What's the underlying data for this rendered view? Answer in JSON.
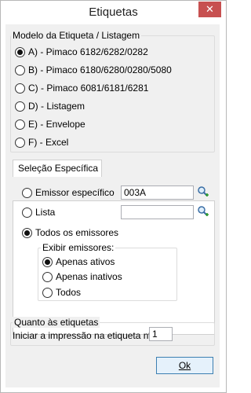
{
  "window": {
    "title": "Etiquetas",
    "close_glyph": "✕"
  },
  "modelo": {
    "legend": "Modelo da Etiqueta / Listagem",
    "options": [
      {
        "label": "A) - Pimaco 6182/6282/0282",
        "checked": true
      },
      {
        "label": "B) - Pimaco 6180/6280/0280/5080",
        "checked": false
      },
      {
        "label": "C) - Pimaco 6081/6181/6281",
        "checked": false
      },
      {
        "label": "D) - Listagem",
        "checked": false
      },
      {
        "label": "E) - Envelope",
        "checked": false
      },
      {
        "label": "F) - Excel",
        "checked": false
      }
    ]
  },
  "selecao": {
    "tab_label": "Seleção Específica",
    "emissor_label": "Emissor específico",
    "emissor_value": "003A",
    "lista_label": "Lista",
    "lista_value": "",
    "todos_label": "Todos os emissores",
    "selected": "todos",
    "exibir": {
      "legend": "Exibir emissores:",
      "options": [
        {
          "label": "Apenas ativos",
          "checked": true
        },
        {
          "label": "Apenas inativos",
          "checked": false
        },
        {
          "label": "Todos",
          "checked": false
        }
      ]
    }
  },
  "quanto": {
    "legend": "Quanto às etiquetas",
    "iniciar_label": "Iniciar a impressão na etiqueta nº",
    "iniciar_value": "1"
  },
  "buttons": {
    "ok": "Ok"
  },
  "colors": {
    "close_bg": "#c75050",
    "ok_border": "#3c7fb1",
    "ok_bg": "#e5f1fb"
  },
  "icons": {
    "search": "search-icon"
  }
}
